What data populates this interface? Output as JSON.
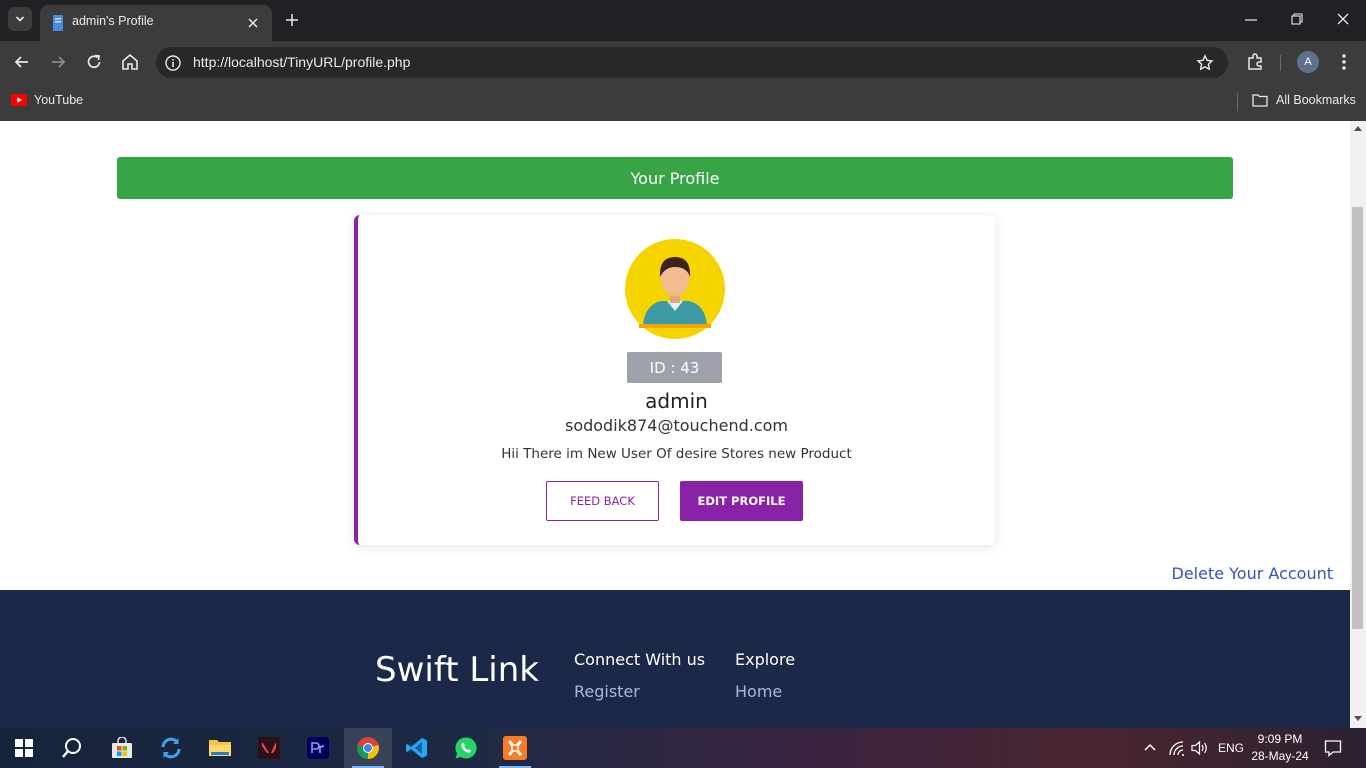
{
  "browser": {
    "tab_title": "admin's Profile",
    "url": "http://localhost/TinyURL/profile.php",
    "profile_initial": "A",
    "bookmarks": [
      {
        "label": "YouTube",
        "icon": "youtube-icon"
      }
    ],
    "all_bookmarks_label": "All Bookmarks"
  },
  "page": {
    "header_title": "Your Profile",
    "profile": {
      "id_label": "ID : 43",
      "username": "admin",
      "email": "sododik874@touchend.com",
      "bio": "Hii There im New User Of desire Stores new Product",
      "feedback_button": "FEED BACK",
      "edit_button": "EDIT PROFILE"
    },
    "delete_link": "Delete Your Account",
    "footer": {
      "brand": "Swift Link",
      "columns": [
        {
          "heading": "Connect With us",
          "links": [
            "Register"
          ]
        },
        {
          "heading": "Explore",
          "links": [
            "Home"
          ]
        }
      ]
    }
  },
  "taskbar": {
    "language": "ENG",
    "time": "9:09 PM",
    "date": "28-May-24",
    "apps": [
      "windows-start-icon",
      "search-icon",
      "microsoft-store-icon",
      "sync-icon",
      "file-explorer-icon",
      "valorant-icon",
      "premiere-pro-icon",
      "chrome-icon",
      "vscode-icon",
      "whatsapp-icon",
      "xampp-icon"
    ]
  },
  "colors": {
    "header_green": "#37a446",
    "accent_purple": "#8a22a8",
    "footer_navy": "#1b2847",
    "link_blue": "#3553b8",
    "avatar_yellow": "#f5d400"
  }
}
